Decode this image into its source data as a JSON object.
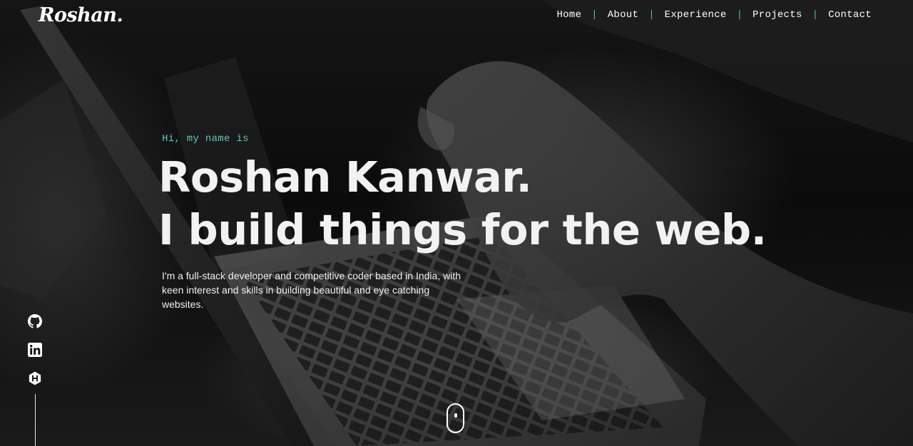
{
  "brand": {
    "logo": "Roshan."
  },
  "nav": {
    "items": [
      {
        "label": "Home"
      },
      {
        "label": "About"
      },
      {
        "label": "Experience"
      },
      {
        "label": "Projects"
      },
      {
        "label": "Contact"
      }
    ],
    "separator": "|"
  },
  "hero": {
    "greeting": "Hi, my name is",
    "name_line": "Roshan Kanwar.",
    "tagline_line": "I build things for the web.",
    "intro": "I'm a full-stack developer and competitive coder based in India, with keen interest and skills in building beautiful and eye catching websites."
  },
  "social": {
    "icons": [
      "github-icon",
      "linkedin-icon",
      "hackerrank-icon"
    ]
  },
  "colors": {
    "accent": "#5ec8be",
    "text": "#f2f2f2",
    "background": "#0a0a0a"
  }
}
